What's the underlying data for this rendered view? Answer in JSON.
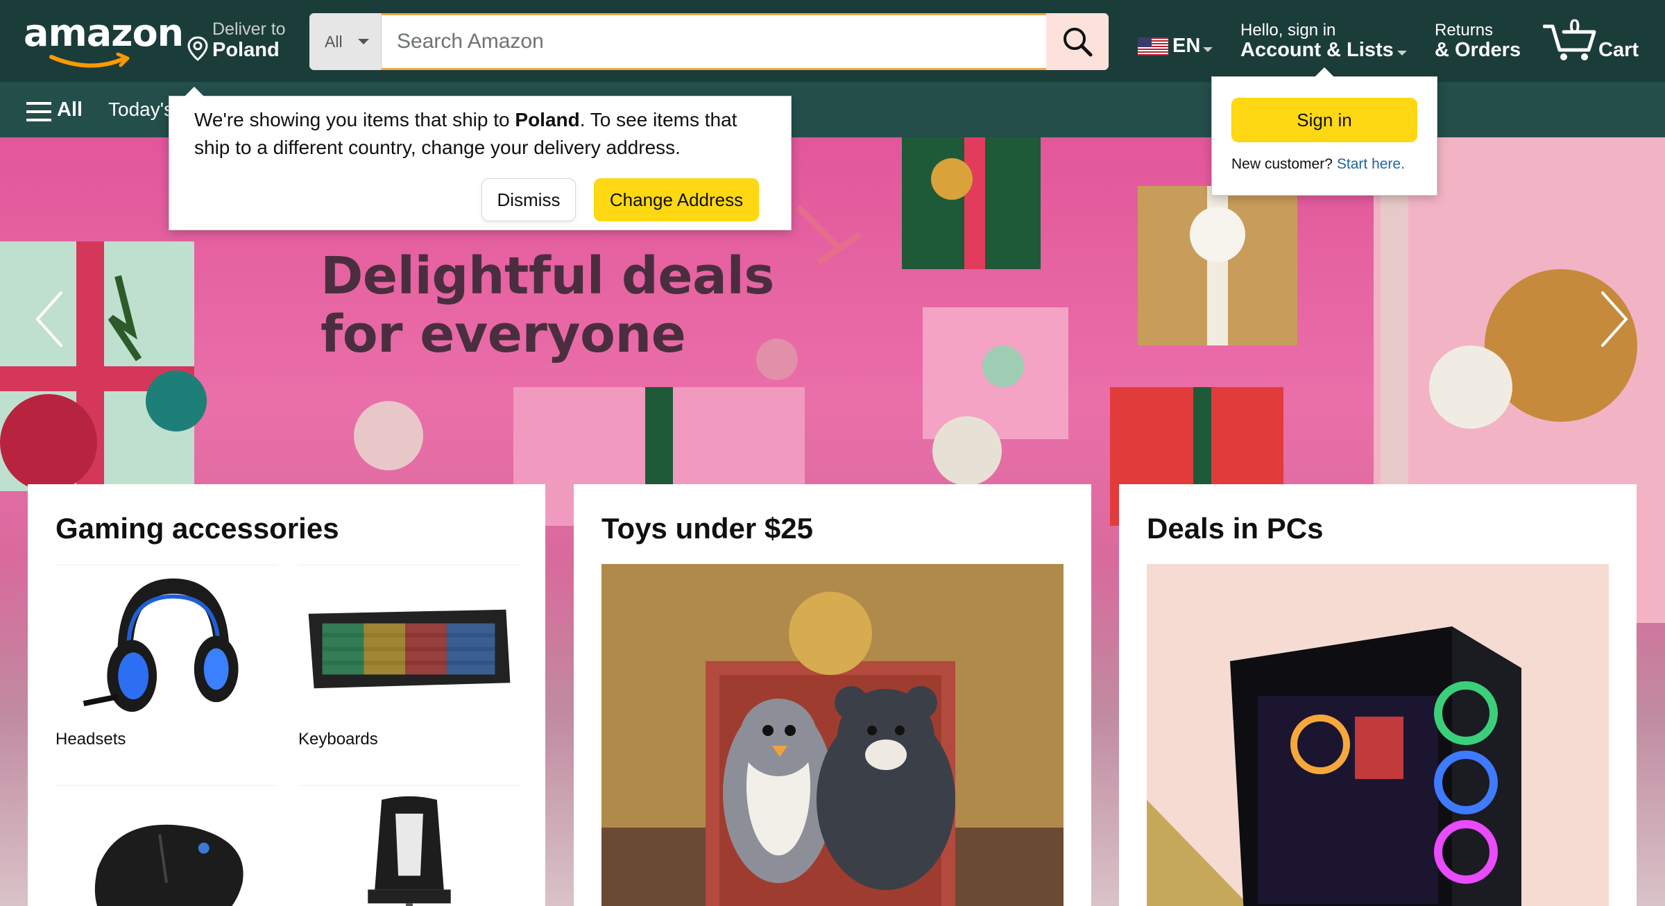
{
  "header": {
    "logo_text": "amazon",
    "deliver": {
      "line1": "Deliver to",
      "line2": "Poland"
    },
    "search": {
      "category": "All",
      "placeholder": "Search Amazon"
    },
    "language": "EN",
    "account": {
      "line1": "Hello, sign in",
      "line2": "Account & Lists"
    },
    "returns": {
      "line1": "Returns",
      "line2": "& Orders"
    },
    "cart": {
      "count": "0",
      "label": "Cart"
    }
  },
  "subnav": {
    "all_label": "All",
    "item": "Today's"
  },
  "hero": {
    "headline_line1": "Delightful deals",
    "headline_line2": "for everyone"
  },
  "ship_popover": {
    "text_before": "We're showing you items that ship to ",
    "country": "Poland",
    "text_after": ". To see items that ship to a different country, change your delivery address.",
    "dismiss_label": "Dismiss",
    "change_label": "Change Address"
  },
  "signin_popover": {
    "button_label": "Sign in",
    "new_customer": "New customer?",
    "start_link": "Start here."
  },
  "cards": [
    {
      "title": "Gaming accessories",
      "items": [
        {
          "label": "Headsets",
          "icon": "headset-image"
        },
        {
          "label": "Keyboards",
          "icon": "keyboard-image"
        },
        {
          "label": "",
          "icon": "mouse-image"
        },
        {
          "label": "",
          "icon": "chair-image"
        }
      ]
    },
    {
      "title": "Toys under $25",
      "image": "plush-toys-image"
    },
    {
      "title": "Deals in PCs",
      "image": "gaming-pc-image"
    }
  ],
  "colors": {
    "nav_bg": "#1b3d3a",
    "subnav_bg": "#234e4a",
    "button_yellow": "#ffd814",
    "link_blue": "#2162a1",
    "hero_pink": "#e2579a"
  }
}
